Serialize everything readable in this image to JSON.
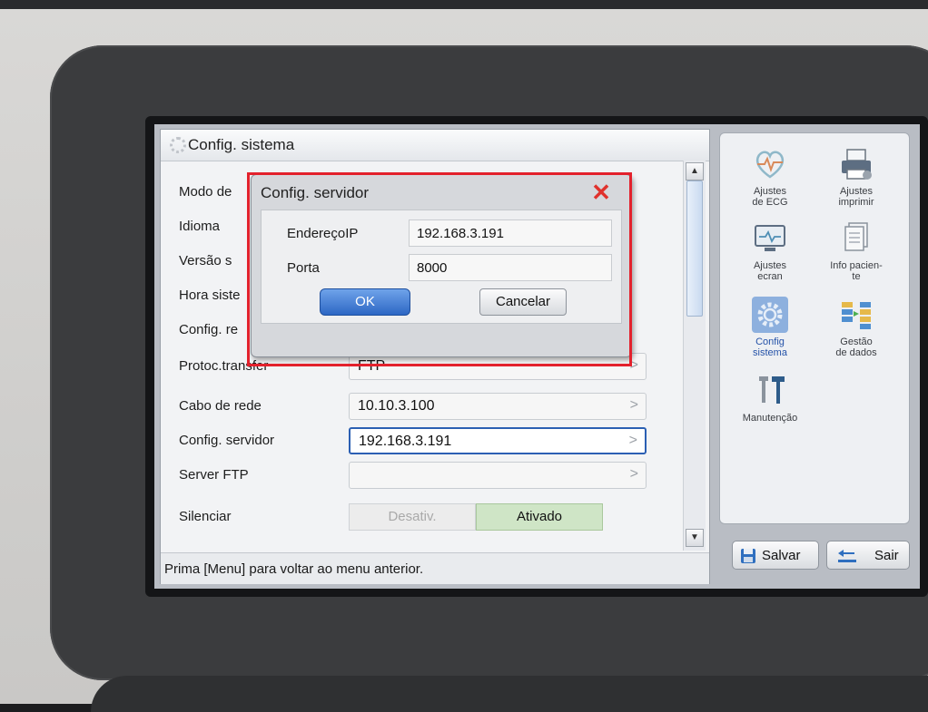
{
  "left_panel": {
    "title": "Config. sistema",
    "rows": [
      {
        "label": "Modo de",
        "value": ""
      },
      {
        "label": "Idioma",
        "value": ""
      },
      {
        "label": "Versão s",
        "value": ""
      },
      {
        "label": "Hora siste",
        "value": ""
      },
      {
        "label": "Config. re",
        "value": ""
      },
      {
        "label": "Protoc.transfer",
        "value": "FTP"
      },
      {
        "label": "Cabo de rede",
        "value": "10.10.3.100"
      },
      {
        "label": "Config. servidor",
        "value": "192.168.3.191"
      },
      {
        "label": "Server FTP",
        "value": ""
      },
      {
        "label": "Silenciar",
        "value": ""
      }
    ],
    "silenciar_toggle": {
      "off": "Desativ.",
      "on": "Ativado",
      "selected": "on"
    },
    "arrow": ">",
    "scroll_up": "▲",
    "scroll_down": "▼",
    "status": "Prima [Menu] para voltar ao menu anterior."
  },
  "dialog": {
    "title": "Config. servidor",
    "close_glyph": "✕",
    "ip_label": "EndereçoIP",
    "ip_value": "192.168.3.191",
    "port_label": "Porta",
    "port_value": "8000",
    "ok": "OK",
    "cancel": "Cancelar"
  },
  "right_panel": {
    "items": [
      {
        "label1": "Ajustes",
        "label2": "de ECG",
        "icon": "heart-ecg-icon"
      },
      {
        "label1": "Ajustes",
        "label2": "imprimir",
        "icon": "printer-icon"
      },
      {
        "label1": "Ajustes",
        "label2": "ecran",
        "icon": "monitor-icon"
      },
      {
        "label1": "Info pacien-",
        "label2": "te",
        "icon": "patient-info-icon"
      },
      {
        "label1": "Config",
        "label2": "sistema",
        "icon": "gear-icon"
      },
      {
        "label1": "Gestão",
        "label2": "de dados",
        "icon": "data-management-icon"
      },
      {
        "label1": "Manutenção",
        "label2": "",
        "icon": "tools-icon"
      }
    ],
    "save": "Salvar",
    "exit": "Sair"
  },
  "colors": {
    "highlight": "#e3212c",
    "accent": "#2d67c4",
    "toggle_on": "#cfe5c6"
  }
}
